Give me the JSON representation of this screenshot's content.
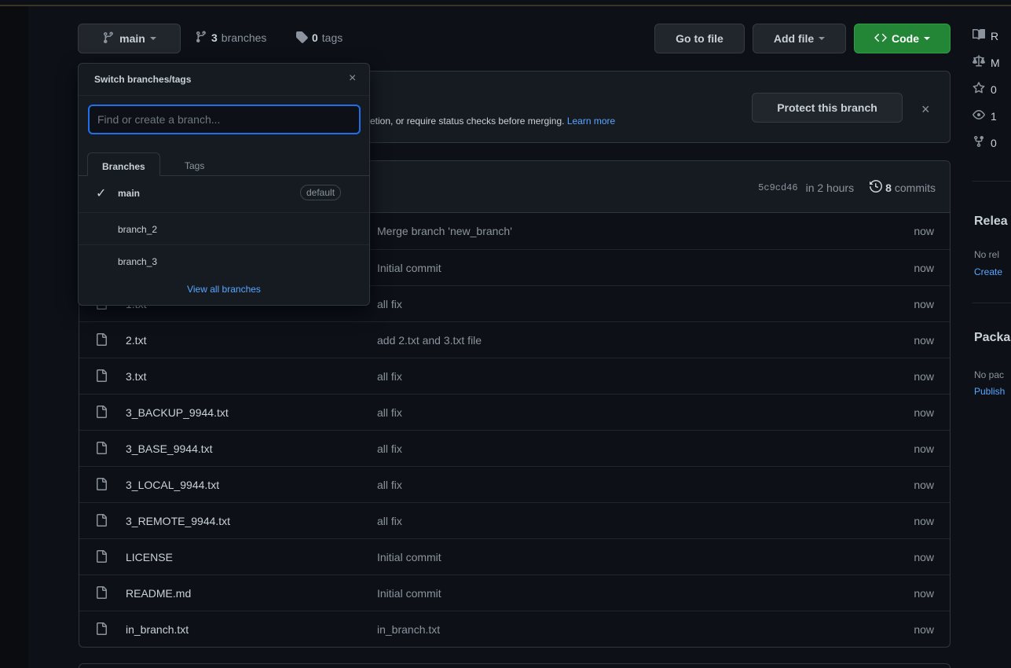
{
  "toolbar": {
    "branch_label": "main",
    "branches_count": "3",
    "branches_text": "branches",
    "tags_count": "0",
    "tags_text": "tags",
    "go_to_file": "Go to file",
    "add_file": "Add file",
    "code": "Code"
  },
  "protect": {
    "description": "etion, or require status checks before merging.",
    "learn_more": "Learn more",
    "button": "Protect this branch",
    "close": "×"
  },
  "commit": {
    "sha": "5c9cd46",
    "time": "in 2 hours",
    "count": "8",
    "count_label": "commits"
  },
  "files": [
    {
      "name": "",
      "message": "Merge branch 'new_branch'",
      "time": "now"
    },
    {
      "name": "",
      "message": "Initial commit",
      "time": "now"
    },
    {
      "name": "1.txt",
      "message": "all fix",
      "time": "now"
    },
    {
      "name": "2.txt",
      "message": "add 2.txt and 3.txt file",
      "time": "now"
    },
    {
      "name": "3.txt",
      "message": "all fix",
      "time": "now"
    },
    {
      "name": "3_BACKUP_9944.txt",
      "message": "all fix",
      "time": "now"
    },
    {
      "name": "3_BASE_9944.txt",
      "message": "all fix",
      "time": "now"
    },
    {
      "name": "3_LOCAL_9944.txt",
      "message": "all fix",
      "time": "now"
    },
    {
      "name": "3_REMOTE_9944.txt",
      "message": "all fix",
      "time": "now"
    },
    {
      "name": "LICENSE",
      "message": "Initial commit",
      "time": "now"
    },
    {
      "name": "README.md",
      "message": "Initial commit",
      "time": "now"
    },
    {
      "name": "in_branch.txt",
      "message": "in_branch.txt",
      "time": "now"
    }
  ],
  "dropdown": {
    "title": "Switch branches/tags",
    "close": "×",
    "search_placeholder": "Find or create a branch...",
    "tab_branches": "Branches",
    "tab_tags": "Tags",
    "items": [
      {
        "label": "main",
        "check": "✓",
        "badge": "default"
      },
      {
        "label": "branch_2"
      },
      {
        "label": "branch_3"
      }
    ],
    "view_all": "View all branches"
  },
  "sidebar": {
    "readme": "R",
    "license": "M",
    "stars": "0",
    "watchers": "1",
    "forks": "0",
    "releases_heading": "Relea",
    "releases_text": "No rel",
    "releases_link": "Create",
    "packages_heading": "Packa",
    "packages_text": "No pac",
    "packages_link": "Publish"
  }
}
